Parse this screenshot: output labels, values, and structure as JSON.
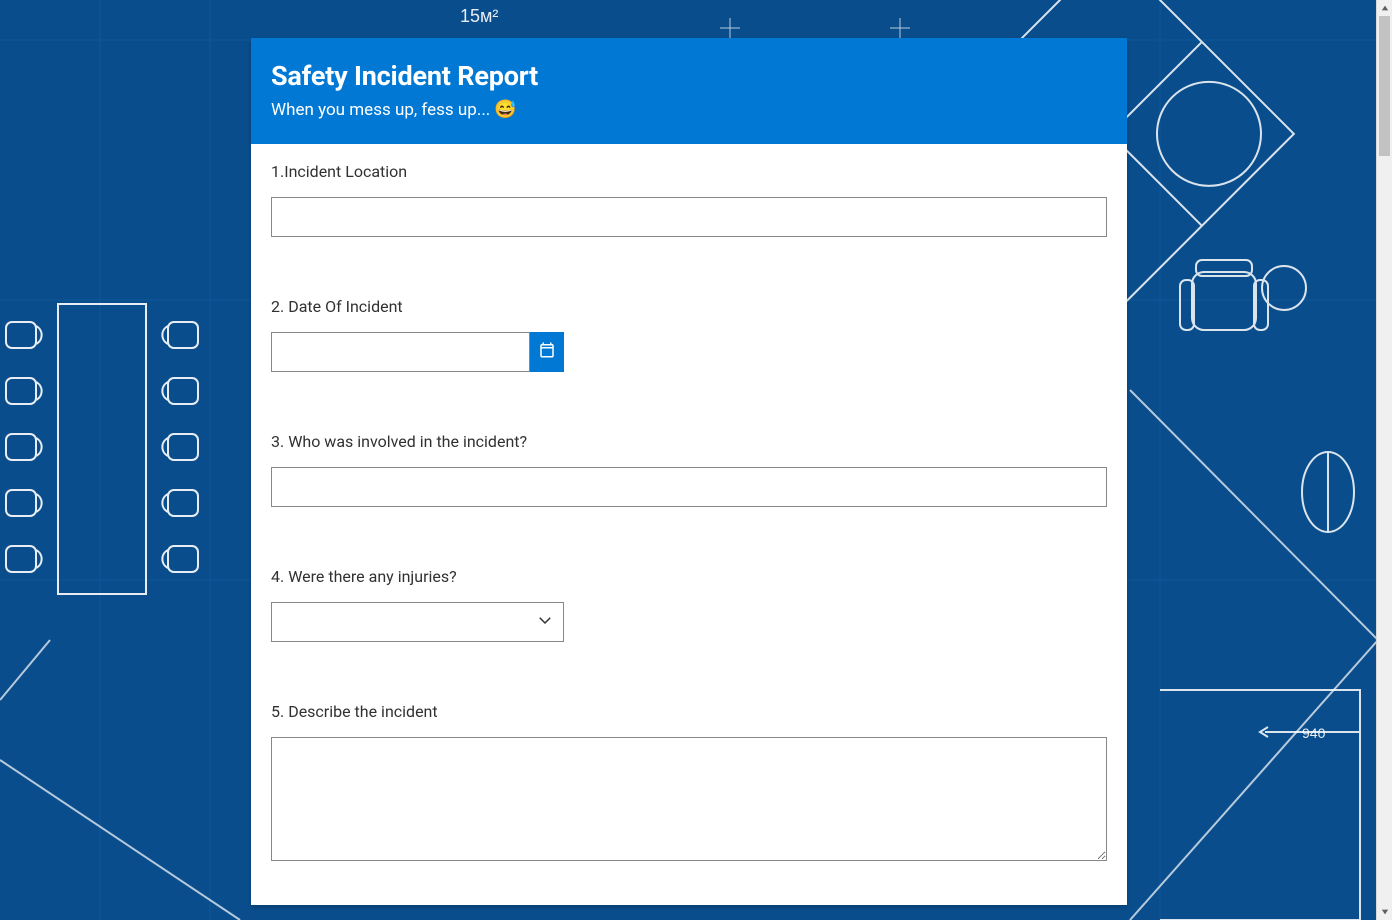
{
  "background_annotations": {
    "area_label": "15м²",
    "dimension_label": "940"
  },
  "form": {
    "title": "Safety Incident Report",
    "subtitle_text": "When you mess up, fess up...",
    "subtitle_emoji": "😅",
    "questions": [
      {
        "number": "1.",
        "label": "Incident Location",
        "type": "text",
        "value": ""
      },
      {
        "number": "2.",
        "label": "Date Of Incident",
        "type": "date",
        "value": ""
      },
      {
        "number": "3.",
        "label": "Who was involved in the incident?",
        "type": "text",
        "value": ""
      },
      {
        "number": "4.",
        "label": "Were there any injuries?",
        "type": "select",
        "value": ""
      },
      {
        "number": "5.",
        "label": "Describe the incident",
        "type": "textarea",
        "value": ""
      }
    ]
  }
}
